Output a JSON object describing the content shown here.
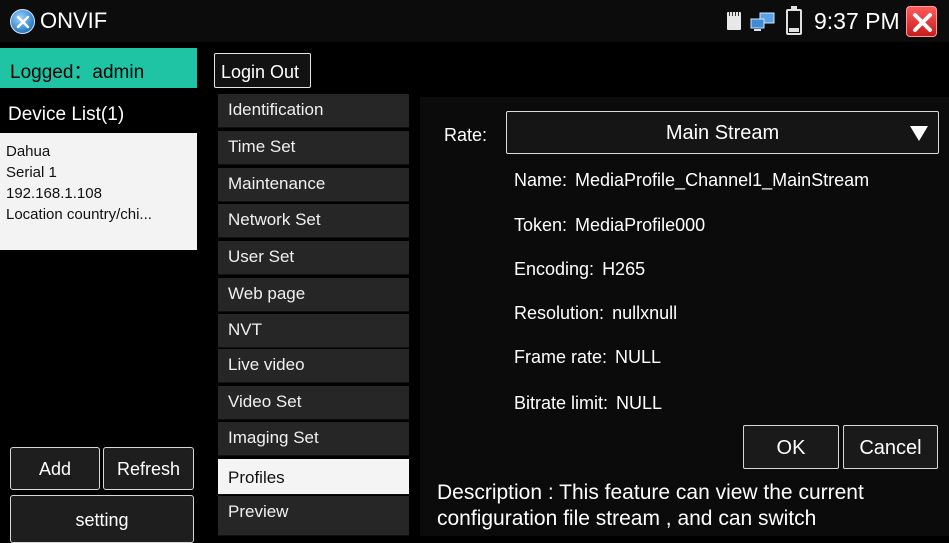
{
  "titlebar": {
    "app_title": "ONVIF",
    "clock": "9:37 PM",
    "close_color": "#d9231f"
  },
  "sidebar": {
    "logged": "Logged：admin",
    "device_list_title": "Device List(1)",
    "device": {
      "name": "Dahua",
      "serial": "Serial 1",
      "ip": "192.168.1.108",
      "location": "Location country/chi..."
    },
    "add_label": "Add",
    "refresh_label": "Refresh",
    "setting_label": "setting"
  },
  "toolbar": {
    "login_out_label": "Login Out"
  },
  "menu": {
    "items": [
      {
        "label": "Identification"
      },
      {
        "label": "Time Set"
      },
      {
        "label": "Maintenance"
      },
      {
        "label": "Network Set"
      },
      {
        "label": "User Set"
      },
      {
        "label": "Web page"
      },
      {
        "label": "NVT"
      },
      {
        "label": "Live video"
      },
      {
        "label": "Video Set"
      },
      {
        "label": "Imaging Set"
      },
      {
        "label": "Profiles"
      },
      {
        "label": "Preview"
      }
    ],
    "active": "Profiles"
  },
  "profile": {
    "rate_label": "Rate:",
    "rate_value": "Main Stream",
    "name_label": "Name:",
    "name_value": "MediaProfile_Channel1_MainStream",
    "token_label": "Token:",
    "token_value": "MediaProfile000",
    "encoding_label": "Encoding:",
    "encoding_value": "H265",
    "resolution_label": "Resolution:",
    "resolution_value": "nullxnull",
    "framerate_label": "Frame rate:",
    "framerate_value": "NULL",
    "bitrate_label": "Bitrate limit:",
    "bitrate_value": "NULL",
    "ok_label": "OK",
    "cancel_label": "Cancel",
    "description": "Description : This feature can view the current configuration file stream , and can switch"
  },
  "colors": {
    "accent": "#1fc4a5",
    "menu_bg": "#262626",
    "active_bg": "#f4f4f4"
  }
}
